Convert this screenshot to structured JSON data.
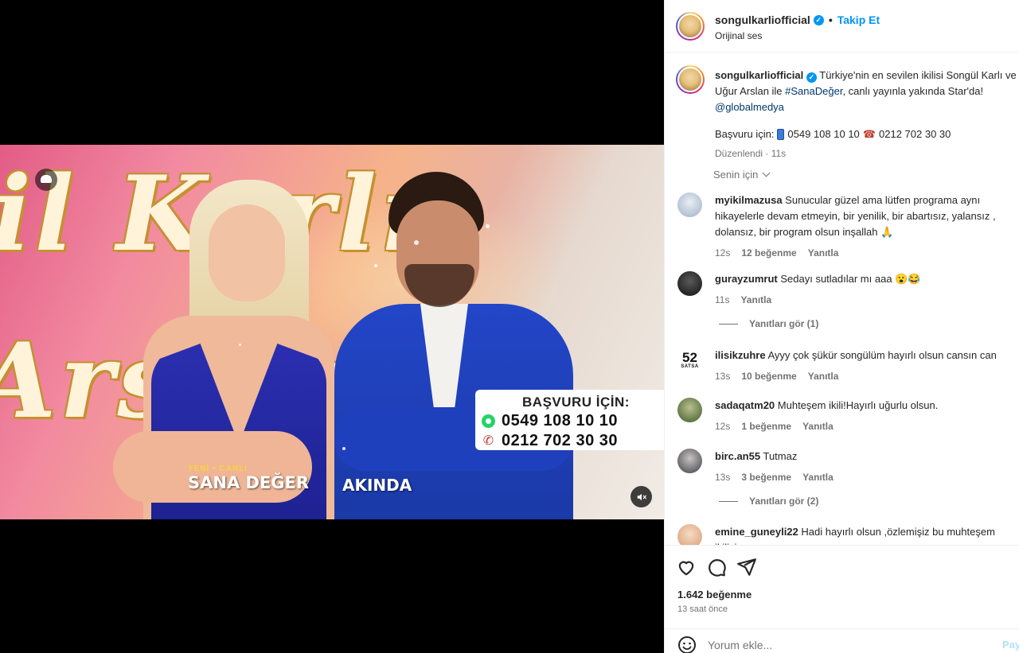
{
  "header": {
    "username": "songulkarliofficial",
    "follow_label": "Takip Et",
    "audio_label": "Orijinal ses"
  },
  "video": {
    "script_line_1": "il Karlı",
    "script_line_2": "Arslan",
    "apply_title": "BAŞVURU İÇİN:",
    "phone_whatsapp": "0549 108 10 10",
    "phone_landline": "0212 702 30 30",
    "show_kicker": "YENİ • CANLI",
    "show_title": "SANA DEĞER",
    "soon_label": "AKINDA"
  },
  "caption": {
    "username": "songulkarliofficial",
    "text_1": "Türkiye'nin en sevilen ikilisi Songül Karlı ve Uğur Arslan ile ",
    "hashtag": "#SanaDeğer",
    "text_2": ", canlı yayınla yakında Star'da!",
    "mention": "@globalmedya",
    "apply_prefix": "Başvuru için:",
    "apply_phone_1": "0549 108 10 10",
    "apply_phone_2": "0212 702 30 30",
    "meta": "Düzenlendi · 11s"
  },
  "sort_label": "Senin için",
  "comments": [
    {
      "username": "myikilmazusa",
      "text": "Sunucular güzel ama lütfen programa aynı hikayelerle devam etmeyin, bir yenilik, bir abartısız, yalansız , dolansız, bir program olsun inşallah 🙏",
      "time": "12s",
      "likes": "12 beğenme",
      "reply": "Yanıtla"
    },
    {
      "username": "gurayzumrut",
      "text": "Sedayı sutladılar mı aaa 😮😂",
      "time": "11s",
      "likes": "",
      "reply": "Yanıtla",
      "view_replies": "Yanıtları gör (1)"
    },
    {
      "username": "ilisikzuhre",
      "text": "Ayyy çok şükür songülüm hayırlı olsun cansın can",
      "time": "13s",
      "likes": "10 beğenme",
      "reply": "Yanıtla"
    },
    {
      "username": "sadaqatm20",
      "text": "Muhteşem ikili!Hayırlı uğurlu olsun.",
      "time": "12s",
      "likes": "1 beğenme",
      "reply": "Yanıtla"
    },
    {
      "username": "birc.an55",
      "text": "Tutmaz",
      "time": "13s",
      "likes": "3 beğenme",
      "reply": "Yanıtla",
      "view_replies": "Yanıtları gör (2)"
    },
    {
      "username": "emine_guneyli22",
      "text": "Hadi hayırlı olsun ,özlemişiz bu muhteşem ikiliyi",
      "time": "",
      "likes": "",
      "reply": ""
    }
  ],
  "avatar_52_text": "52",
  "avatar_52_sub": "SATSA",
  "actions": {
    "likes": "1.642 beğenme",
    "time_ago": "13 saat önce"
  },
  "add_comment": {
    "placeholder": "Yorum ekle...",
    "post_label": "Paylaş"
  },
  "colors": {
    "link_blue": "#0095f6",
    "verified_blue": "#0095f6",
    "text_dark": "#262626",
    "text_muted": "#737373"
  }
}
